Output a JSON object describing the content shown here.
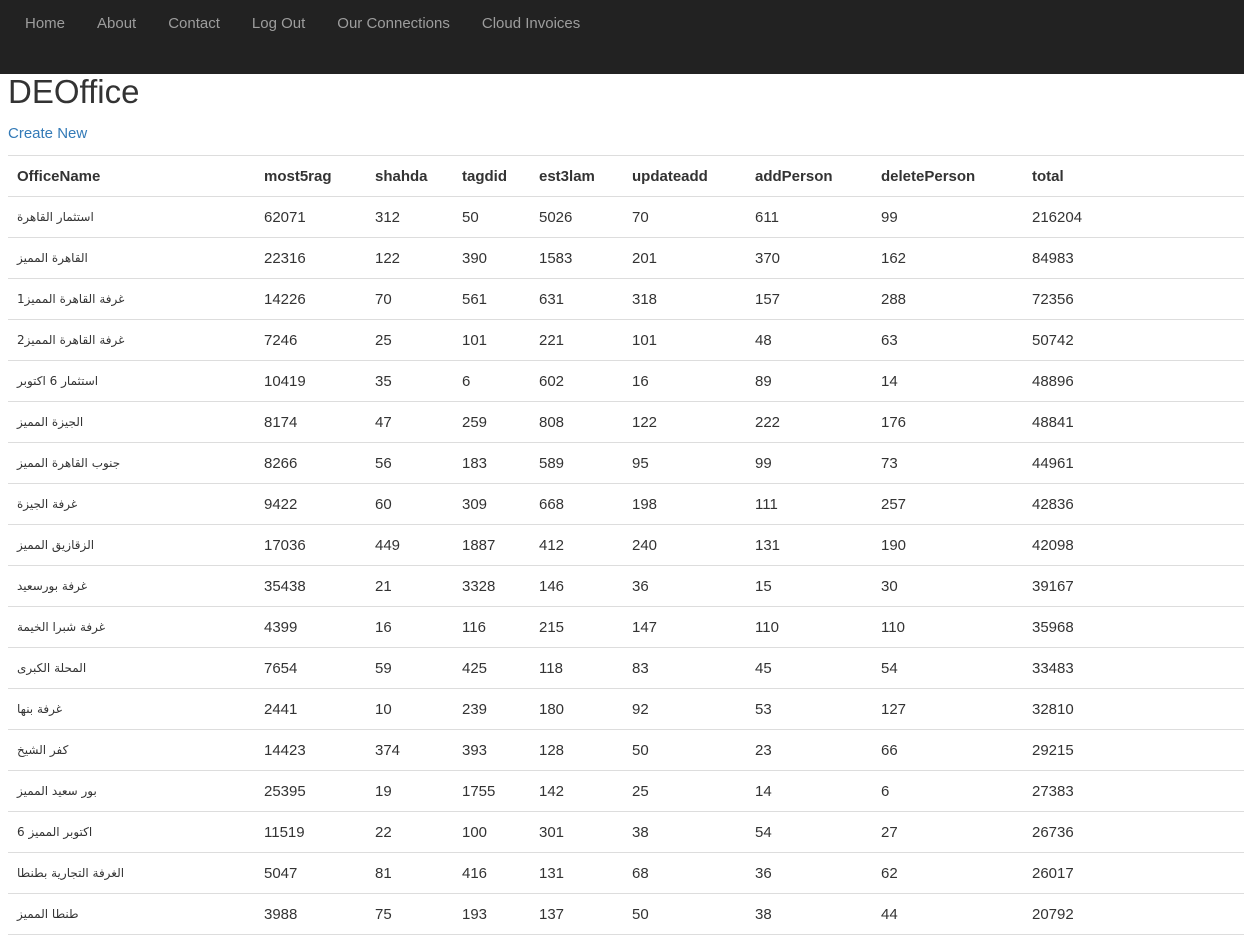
{
  "nav": {
    "items": [
      "Home",
      "About",
      "Contact",
      "Log Out",
      "Our Connections",
      "Cloud Invoices"
    ]
  },
  "page": {
    "title": "DEOffice",
    "create_new": "Create New"
  },
  "table": {
    "headers": [
      "OfficeName",
      "most5rag",
      "shahda",
      "tagdid",
      "est3lam",
      "updateadd",
      "addPerson",
      "deletePerson",
      "total"
    ],
    "rows": [
      [
        "استثمار القاهرة",
        "62071",
        "312",
        "50",
        "5026",
        "70",
        "611",
        "99",
        "216204"
      ],
      [
        "القاهرة المميز",
        "22316",
        "122",
        "390",
        "1583",
        "201",
        "370",
        "162",
        "84983"
      ],
      [
        "غرفة القاهرة المميز1",
        "14226",
        "70",
        "561",
        "631",
        "318",
        "157",
        "288",
        "72356"
      ],
      [
        "غرفة القاهرة المميز2",
        "7246",
        "25",
        "101",
        "221",
        "101",
        "48",
        "63",
        "50742"
      ],
      [
        "استثمار 6 اكتوبر",
        "10419",
        "35",
        "6",
        "602",
        "16",
        "89",
        "14",
        "48896"
      ],
      [
        "الجيزة المميز",
        "8174",
        "47",
        "259",
        "808",
        "122",
        "222",
        "176",
        "48841"
      ],
      [
        "جنوب القاهرة المميز",
        "8266",
        "56",
        "183",
        "589",
        "95",
        "99",
        "73",
        "44961"
      ],
      [
        "غرفة الجيزة",
        "9422",
        "60",
        "309",
        "668",
        "198",
        "111",
        "257",
        "42836"
      ],
      [
        "الزقازيق المميز",
        "17036",
        "449",
        "1887",
        "412",
        "240",
        "131",
        "190",
        "42098"
      ],
      [
        "غرفة بورسعيد",
        "35438",
        "21",
        "3328",
        "146",
        "36",
        "15",
        "30",
        "39167"
      ],
      [
        "غرفة شبرا الخيمة",
        "4399",
        "16",
        "116",
        "215",
        "147",
        "110",
        "110",
        "35968"
      ],
      [
        "المحلة الكبرى",
        "7654",
        "59",
        "425",
        "118",
        "83",
        "45",
        "54",
        "33483"
      ],
      [
        "غرفة بنها",
        "2441",
        "10",
        "239",
        "180",
        "92",
        "53",
        "127",
        "32810"
      ],
      [
        "كفر الشيخ",
        "14423",
        "374",
        "393",
        "128",
        "50",
        "23",
        "66",
        "29215"
      ],
      [
        "بور سعيد المميز",
        "25395",
        "19",
        "1755",
        "142",
        "25",
        "14",
        "6",
        "27383"
      ],
      [
        "اكتوبر المميز 6",
        "11519",
        "22",
        "100",
        "301",
        "38",
        "54",
        "27",
        "26736"
      ],
      [
        "الغرفة التجارية بطنطا",
        "5047",
        "81",
        "416",
        "131",
        "68",
        "36",
        "62",
        "26017"
      ],
      [
        "طنطا المميز",
        "3988",
        "75",
        "193",
        "137",
        "50",
        "38",
        "44",
        "20792"
      ]
    ]
  }
}
